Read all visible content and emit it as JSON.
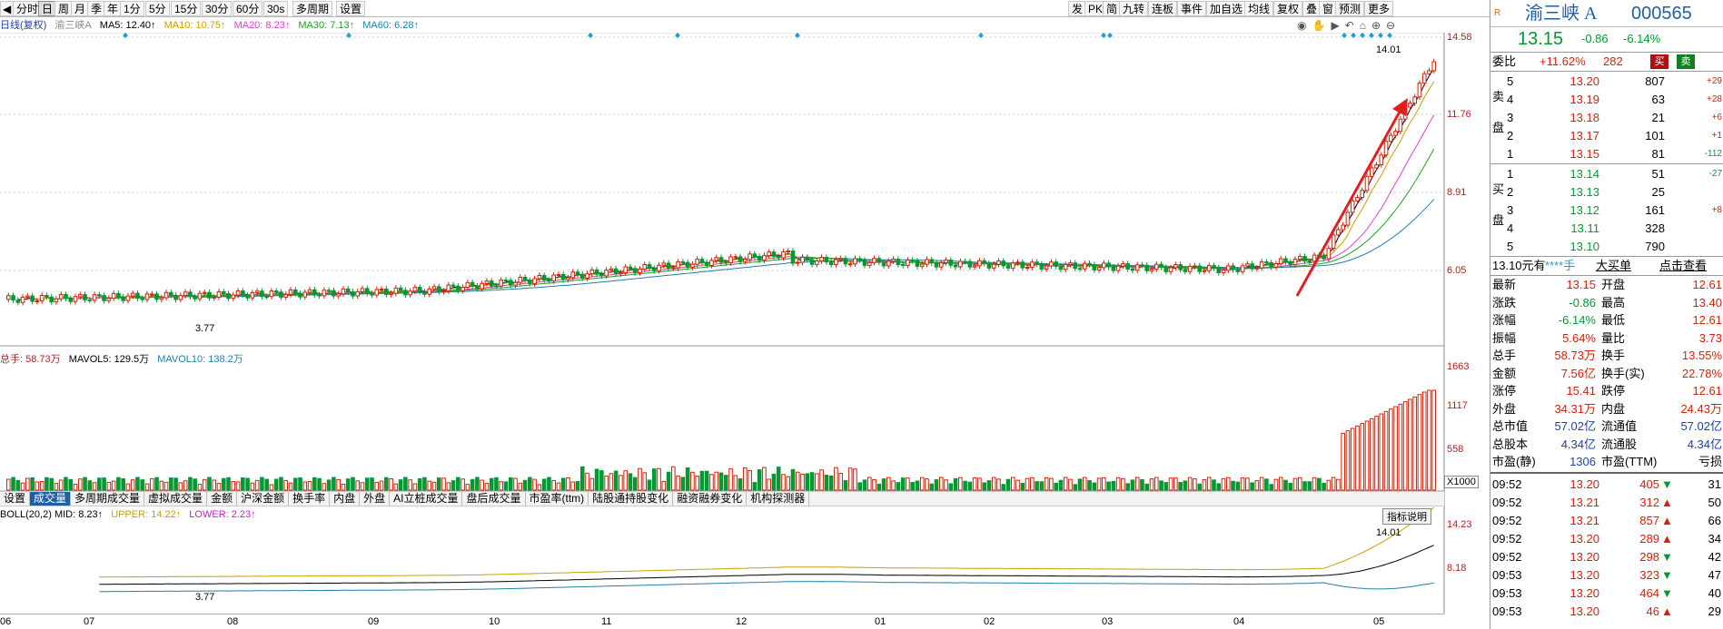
{
  "toolbar_left": [
    "分时",
    "日",
    "周",
    "月",
    "季",
    "年",
    "1分",
    "5分",
    "15分",
    "30分",
    "60分",
    "30s",
    "多周期",
    "设置"
  ],
  "toolbar_right": [
    "发",
    "PK",
    "简",
    "九转",
    "连板",
    "事件",
    "加自选",
    "均线",
    "复权",
    "叠",
    "窗",
    "预测",
    "更多"
  ],
  "ma_bar": {
    "label": "日线(复权)",
    "name": "渝三峡A",
    "ma5": "MA5: 12.40↑",
    "ma10": "MA10: 10.75↑",
    "ma20": "MA20: 8.23↑",
    "ma30": "MA30: 7.13↑",
    "ma60": "MA60: 6.28↑"
  },
  "price_axis": [
    "14.58",
    "11.76",
    "8.91",
    "6.05"
  ],
  "annotations": {
    "high": "14.01",
    "low": "3.77",
    "low2": "3.77",
    "high2": "14.01"
  },
  "vol_bar": {
    "total": "总手: 58.73万",
    "mavol5": "MAVOL5: 129.5万",
    "mavol10": "MAVOL10: 138.2万"
  },
  "vol_axis": [
    "1663",
    "1117",
    "558"
  ],
  "vol_unit": "X1000",
  "tabs": [
    "设置",
    "成交量",
    "多周期成交量",
    "虚拟成交量",
    "金额",
    "沪深金额",
    "换手率",
    "内盘",
    "外盘",
    "AI立桩成交量",
    "盘后成交量",
    "市盈率(ttm)",
    "陆股通持股变化",
    "融资融券变化",
    "机构探测器"
  ],
  "boll_bar": {
    "label": "BOLL(20,2)",
    "mid": "MID: 8.23↑",
    "upper": "UPPER: 14.22↑",
    "lower": "LOWER: 2.23↑"
  },
  "boll_axis": [
    "14.23",
    "8.18"
  ],
  "indicator_btn": "指标说明",
  "x_labels": [
    "06",
    "07",
    "08",
    "09",
    "10",
    "11",
    "12",
    "01",
    "02",
    "03",
    "04",
    "05"
  ],
  "quote": {
    "name": "渝三峡 A",
    "code": "000565",
    "price": "13.15",
    "change": "-0.86",
    "pct": "-6.14%",
    "weibi_label": "委比",
    "weibi": "+11.62%",
    "weicha": "282",
    "buy": "买",
    "sell": "卖"
  },
  "sell_orders": [
    {
      "n": "5",
      "p": "13.20",
      "v": "807",
      "d": "+29"
    },
    {
      "n": "4",
      "p": "13.19",
      "v": "63",
      "d": "+28"
    },
    {
      "n": "3",
      "p": "13.18",
      "v": "21",
      "d": "+6"
    },
    {
      "n": "2",
      "p": "13.17",
      "v": "101",
      "d": "+1"
    },
    {
      "n": "1",
      "p": "13.15",
      "v": "81",
      "d": "-112"
    }
  ],
  "buy_orders": [
    {
      "n": "1",
      "p": "13.14",
      "v": "51",
      "d": "-27"
    },
    {
      "n": "2",
      "p": "13.13",
      "v": "25",
      "d": ""
    },
    {
      "n": "3",
      "p": "13.12",
      "v": "161",
      "d": "+8"
    },
    {
      "n": "4",
      "p": "13.11",
      "v": "328",
      "d": ""
    },
    {
      "n": "5",
      "p": "13.10",
      "v": "790",
      "d": ""
    }
  ],
  "sell_side": "卖盘",
  "buy_side": "买盘",
  "bigorder": {
    "a": "13.10元有",
    "b": "****手",
    "c": "大买单",
    "d": "点击查看"
  },
  "stats": [
    [
      "最新",
      "13.15",
      "开盘",
      "12.61"
    ],
    [
      "涨跌",
      "-0.86",
      "最高",
      "13.40"
    ],
    [
      "涨幅",
      "-6.14%",
      "最低",
      "12.61"
    ],
    [
      "振幅",
      "5.64%",
      "量比",
      "3.73"
    ],
    [
      "总手",
      "58.73万",
      "换手",
      "13.55%"
    ],
    [
      "金额",
      "7.56亿",
      "换手(实)",
      "22.78%"
    ],
    [
      "涨停",
      "15.41",
      "跌停",
      "12.61"
    ],
    [
      "外盘",
      "34.31万",
      "内盘",
      "24.43万"
    ],
    [
      "总市值",
      "57.02亿",
      "流通值",
      "57.02亿"
    ],
    [
      "总股本",
      "4.34亿",
      "流通股",
      "4.34亿"
    ],
    [
      "市盈(静)",
      "1306",
      "市盈(TTM)",
      "亏损"
    ]
  ],
  "ticks": [
    [
      "09:52",
      "13.20",
      "405",
      "31"
    ],
    [
      "09:52",
      "13.21",
      "312",
      "50"
    ],
    [
      "09:52",
      "13.21",
      "857",
      "66"
    ],
    [
      "09:52",
      "13.20",
      "289",
      "34"
    ],
    [
      "09:52",
      "13.20",
      "298",
      "42"
    ],
    [
      "09:53",
      "13.20",
      "323",
      "47"
    ],
    [
      "09:53",
      "13.20",
      "464",
      "40"
    ],
    [
      "09:53",
      "13.20",
      "46",
      "29"
    ]
  ],
  "colors": {
    "up": "#d81e06",
    "down": "#009933",
    "ma5": "#000000",
    "ma10": "#c8a000",
    "ma20": "#e040c0",
    "ma30": "#20a020",
    "ma60": "#1f7fa6"
  }
}
